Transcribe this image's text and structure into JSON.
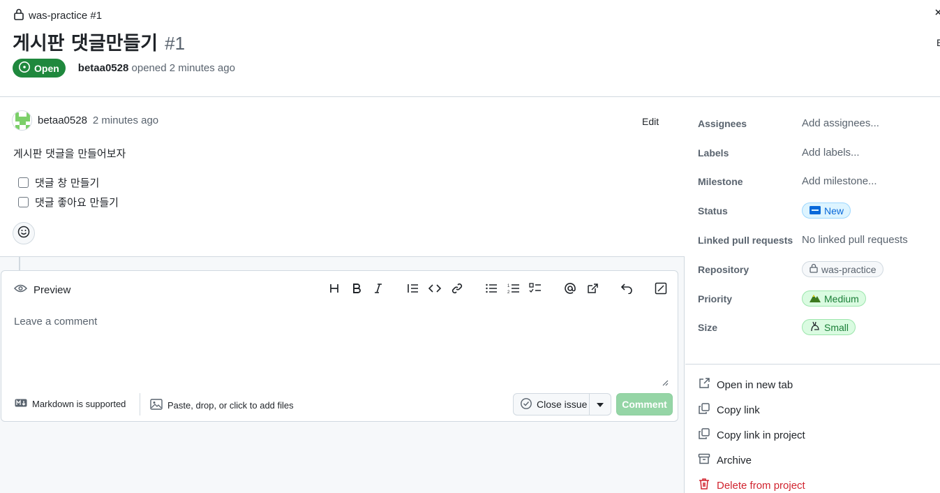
{
  "header": {
    "repo_ref": "was-practice #1",
    "title": "게시판 댓글만들기",
    "number": "#1",
    "state": "Open",
    "author": "betaa0528",
    "opened_text": "opened 2 minutes ago",
    "edge_letter": "E"
  },
  "issue_body": {
    "author": "betaa0528",
    "time": "2 minutes ago",
    "edit_label": "Edit",
    "text": "게시판 댓글을 만들어보자",
    "tasks": [
      {
        "label": "댓글 창 만들기",
        "checked": false
      },
      {
        "label": "댓글 좋아요 만들기",
        "checked": false
      }
    ]
  },
  "composer": {
    "preview_label": "Preview",
    "placeholder": "Leave a comment",
    "markdown_hint": "Markdown is supported",
    "attach_hint": "Paste, drop, or click to add files",
    "close_label": "Close issue",
    "comment_label": "Comment",
    "toolbar_icons": [
      "heading-icon",
      "bold-icon",
      "italic-icon",
      "quote-icon",
      "code-icon",
      "link-icon",
      "unordered-list-icon",
      "ordered-list-icon",
      "task-list-icon",
      "mention-icon",
      "reference-icon",
      "undo-icon",
      "fullscreen-icon"
    ]
  },
  "sidebar": {
    "fields": [
      {
        "label": "Assignees",
        "value": "Add assignees..."
      },
      {
        "label": "Labels",
        "value": "Add labels..."
      },
      {
        "label": "Milestone",
        "value": "Add milestone..."
      },
      {
        "label": "Status",
        "value": "New"
      },
      {
        "label": "Linked pull requests",
        "value": "No linked pull requests"
      },
      {
        "label": "Repository",
        "value": "was-practice"
      },
      {
        "label": "Priority",
        "value": "Medium"
      },
      {
        "label": "Size",
        "value": "Small"
      }
    ],
    "actions": [
      {
        "label": "Open in new tab",
        "icon": "external-link-icon"
      },
      {
        "label": "Copy link",
        "icon": "copy-icon"
      },
      {
        "label": "Copy link in project",
        "icon": "copy-icon"
      },
      {
        "label": "Archive",
        "icon": "archive-icon"
      },
      {
        "label": "Delete from project",
        "icon": "trash-icon"
      }
    ]
  },
  "colors": {
    "open_green": "#1f883d",
    "danger_red": "#d1242f",
    "link_blue": "#0969da",
    "comment_disabled": "#95d5a6"
  }
}
